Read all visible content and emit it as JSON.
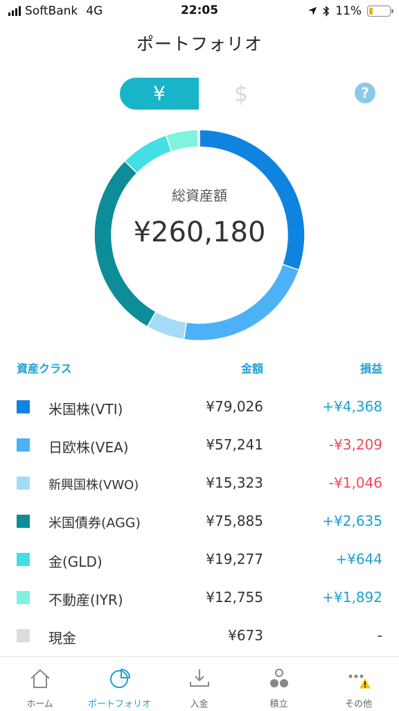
{
  "status_bar": {
    "carrier": "SoftBank",
    "network": "4G",
    "time": "22:05",
    "battery": "11%"
  },
  "nav": {
    "title": "ポートフォリオ"
  },
  "currency_toggle": {
    "yen": "¥",
    "usd": "$",
    "selected": "yen"
  },
  "help": {
    "label": "?"
  },
  "summary": {
    "label": "総資産額",
    "total": "¥260,180"
  },
  "table": {
    "headers": {
      "asset_class": "資産クラス",
      "amount": "金額",
      "profit_loss": "損益"
    },
    "rows": [
      {
        "name": "米国株(VTI)",
        "amount": "¥79,026",
        "amount_value": 79026,
        "pl": "+¥4,368",
        "pl_sign": "positive",
        "color": "#0e83e0"
      },
      {
        "name": "日欧株(VEA)",
        "amount": "¥57,241",
        "amount_value": 57241,
        "pl": "-¥3,209",
        "pl_sign": "negative",
        "color": "#4db1f8"
      },
      {
        "name": "新興国株(VWO)",
        "amount": "¥15,323",
        "amount_value": 15323,
        "pl": "-¥1,046",
        "pl_sign": "negative",
        "color": "#a4dcf8"
      },
      {
        "name": "米国債券(AGG)",
        "amount": "¥75,885",
        "amount_value": 75885,
        "pl": "+¥2,635",
        "pl_sign": "positive",
        "color": "#0c8d97"
      },
      {
        "name": "金(GLD)",
        "amount": "¥19,277",
        "amount_value": 19277,
        "pl": "+¥644",
        "pl_sign": "positive",
        "color": "#42dfe6"
      },
      {
        "name": "不動産(IYR)",
        "amount": "¥12,755",
        "amount_value": 12755,
        "pl": "+¥1,892",
        "pl_sign": "positive",
        "color": "#7ff3dd"
      },
      {
        "name": "現金",
        "amount": "¥673",
        "amount_value": 673,
        "pl": "-",
        "pl_sign": "neutral",
        "color": "#dcdcdc"
      }
    ]
  },
  "colors": {
    "positive": "#1d9fd6",
    "negative": "#f0485e",
    "neutral": "#333333",
    "accent": "#1ab4c8"
  },
  "tabs": [
    {
      "label": "ホーム",
      "icon": "home-icon",
      "active": false
    },
    {
      "label": "ポートフォリオ",
      "icon": "portfolio-pie-icon",
      "active": true
    },
    {
      "label": "入金",
      "icon": "deposit-icon",
      "active": false
    },
    {
      "label": "積立",
      "icon": "accumulate-icon",
      "active": false
    },
    {
      "label": "その他",
      "icon": "more-icon",
      "active": false
    }
  ]
}
